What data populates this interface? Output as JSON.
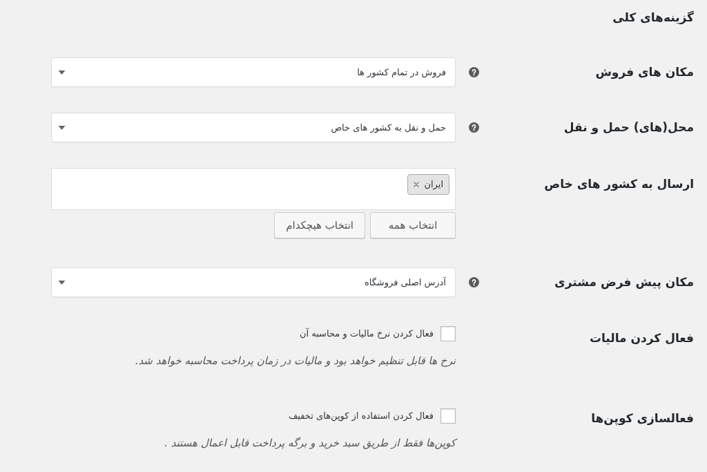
{
  "heading": "گزینه‌های کلی",
  "fields": [
    {
      "kind": "select",
      "label": "مکان های فروش",
      "help": true,
      "value": "فروش در تمام کشور ها"
    },
    {
      "kind": "select",
      "label": "محل(های) حمل و نقل",
      "help": true,
      "value": "حمل و نقل به کشور های خاص"
    },
    {
      "kind": "multiselect",
      "label": "ارسال به کشور های خاص",
      "help": false,
      "tags": [
        "ایران"
      ],
      "buttons": [
        "انتخاب همه",
        "انتخاب هیچکدام"
      ]
    },
    {
      "kind": "select",
      "label": "مکان پیش فرض مشتری",
      "help": true,
      "value": "آدرس اصلی فروشگاه"
    },
    {
      "kind": "checkbox",
      "label": "فعال کردن مالیات",
      "help": false,
      "checkbox_label": "فعال کردن نرخ مالیات و محاسبه آن",
      "checked": false,
      "description": "نرخ ها قابل تنظیم خواهد بود و مالیات در زمان پرداخت محاسبه خواهد شد."
    },
    {
      "kind": "checkbox",
      "label": "فعالسازی کوپن‌ها",
      "help": false,
      "checkbox_label": "فعال کردن استفاده از کوپن‌های تخفیف",
      "checked": false,
      "description": "کوپن‌ها فقط از طریق سبد خرید و برگه پرداخت قابل اعمال هستند ."
    }
  ]
}
